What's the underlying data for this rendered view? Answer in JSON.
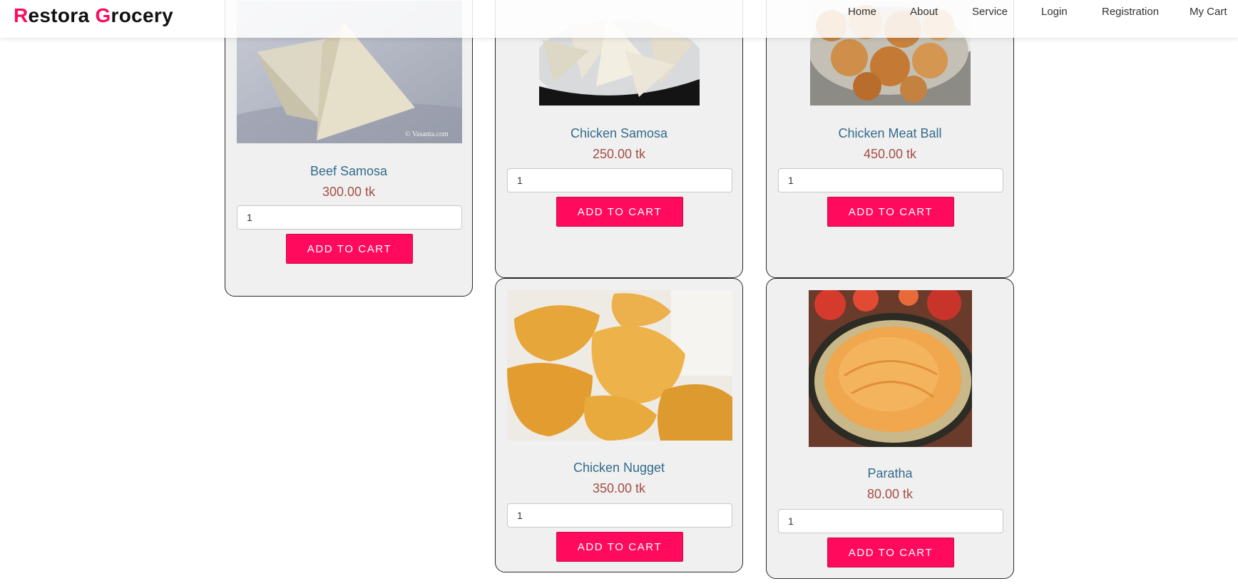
{
  "brand": {
    "initial_1": "R",
    "rest_1": "estora ",
    "initial_2": "G",
    "rest_2": "rocery",
    "accent_color": "#ff0a5c"
  },
  "nav": {
    "home": "Home",
    "about": "About",
    "service": "Service",
    "login": "Login",
    "registration": "Registration",
    "cart": "My Cart"
  },
  "products": [
    {
      "name": "Beef Samosa",
      "price": "300.00 tk",
      "qty": "1",
      "button": "ADD TO CART",
      "image": "beef-samosa-photo"
    },
    {
      "name": "Chicken Samosa",
      "price": "250.00 tk",
      "qty": "1",
      "button": "ADD TO CART",
      "image": "chicken-samosa-photo"
    },
    {
      "name": "Chicken Meat Ball",
      "price": "450.00 tk",
      "qty": "1",
      "button": "ADD TO CART",
      "image": "chicken-meat-ball-photo"
    },
    {
      "name": "Chicken Nugget",
      "price": "350.00 tk",
      "qty": "1",
      "button": "ADD TO CART",
      "image": "chicken-nugget-photo"
    },
    {
      "name": "Paratha",
      "price": "80.00 tk",
      "qty": "1",
      "button": "ADD TO CART",
      "image": "paratha-photo"
    }
  ],
  "colors": {
    "primary_button": "#ff0a5c",
    "product_name": "#336b8a",
    "product_price": "#a44f45",
    "card_background": "#f0f0f0"
  }
}
